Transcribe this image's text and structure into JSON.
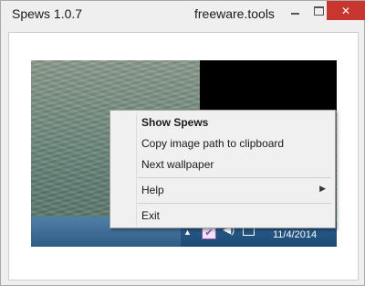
{
  "window": {
    "title": "Spews 1.0.7",
    "site": "freeware.tools",
    "controls": {
      "close_symbol": "✕"
    },
    "accent_color": "#c7372f"
  },
  "preview": {
    "taskbar": {
      "clock": "11/4/2014"
    }
  },
  "context_menu": {
    "items": [
      {
        "label": "Show Spews",
        "bold": true
      },
      {
        "label": "Copy image path to clipboard"
      },
      {
        "label": "Next wallpaper"
      },
      {
        "label": "Help",
        "has_submenu": true
      },
      {
        "label": "Exit"
      }
    ]
  }
}
